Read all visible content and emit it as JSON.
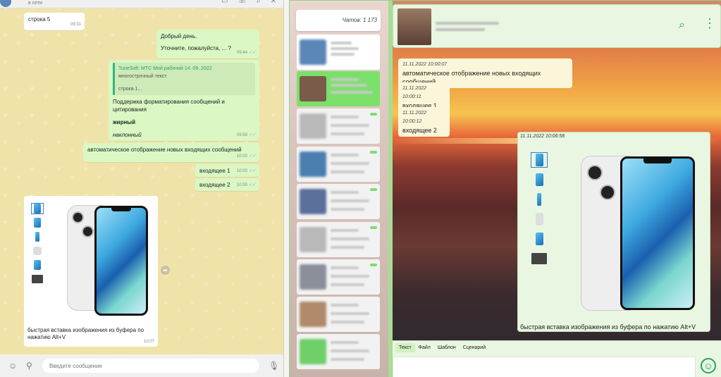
{
  "left": {
    "header": {
      "status": "в сети"
    },
    "messages": [
      {
        "text": "строка 5",
        "time": "09:31"
      },
      {
        "line1": "Добрый день.",
        "line2": "Уточните, пожалуйста, ... ?",
        "time": "09:44"
      },
      {
        "quote_header": "TuneSoft: МТС Мой рабочий 14. 09. 2022",
        "quote_line1": "многострочный текст",
        "quote_line2": "строка 1...",
        "line1": "Поддержка форматирования сообщений и цитирования",
        "bold": "жирный",
        "italic": "наклонный",
        "time": "09:58"
      },
      {
        "text": "автоматическое отображение новых входящих сообщений",
        "time": "10:00"
      },
      {
        "text": "входящее 1",
        "time": "10:00"
      },
      {
        "text": "входящее 2",
        "time": "10:00"
      }
    ],
    "media_caption": "быстрая вставка изображения из буфера по нажатию Alt+V",
    "media_time": "10:07",
    "input_placeholder": "Введите сообщение"
  },
  "right": {
    "chats_count": "Чатов: 1 173",
    "messages": [
      {
        "ts": "11.11.2022 10:00:07",
        "text": "автоматическое отображение новых входящих сообщений"
      },
      {
        "ts": "11.11.2022 10:00:11",
        "text": "входящее 1"
      },
      {
        "ts": "11.11.2022 10:00:12",
        "text": "входящее 2"
      }
    ],
    "media": {
      "ts": "11.11.2022 10:06:58",
      "caption": "быстрая вставка изображения из буфера по нажатию Alt+V"
    },
    "composer_tabs": [
      "Текст",
      "Файл",
      "Шаблон",
      "Сценарий"
    ]
  },
  "colors": {
    "accent_green": "#2aa06b",
    "bubble_out": "#daf7c4",
    "wallpaper": "#efe3a9"
  },
  "icons": [
    "video-icon",
    "phone-icon",
    "search-icon",
    "menu-icon",
    "emoji-icon",
    "attach-icon",
    "mic-icon",
    "forward-icon",
    "chat-search-icon",
    "kebab-icon",
    "smile-icon"
  ]
}
